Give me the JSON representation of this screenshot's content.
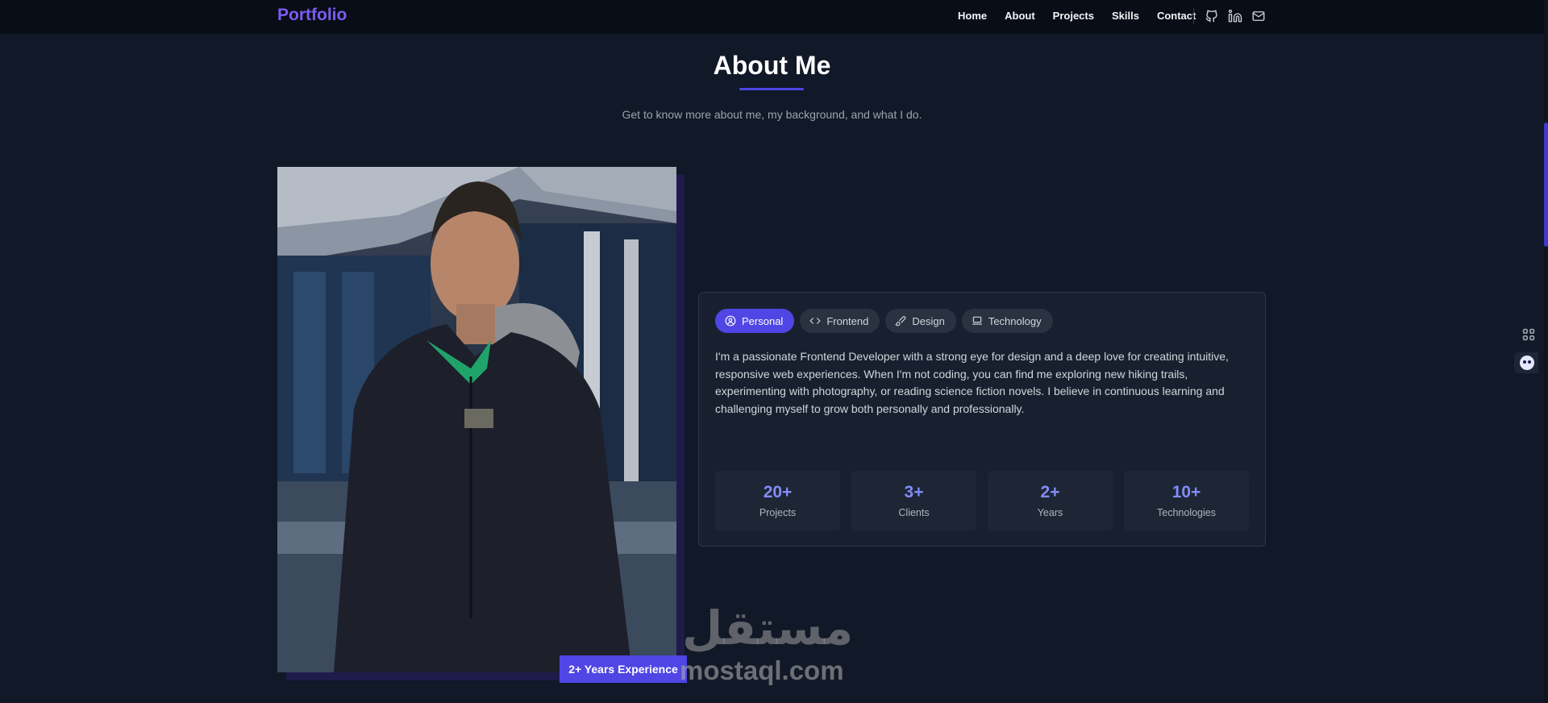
{
  "nav": {
    "brand": "Portfolio",
    "links": [
      "Home",
      "About",
      "Projects",
      "Skills",
      "Contact"
    ],
    "icons": [
      "github-icon",
      "linkedin-icon",
      "mail-icon"
    ]
  },
  "about": {
    "title": "About Me",
    "subtitle": "Get to know more about me, my background, and what I do.",
    "experience_badge": "2+ Years Experience",
    "tabs": [
      {
        "label": "Personal",
        "icon": "user-circle-icon",
        "active": true
      },
      {
        "label": "Frontend",
        "icon": "code-icon",
        "active": false
      },
      {
        "label": "Design",
        "icon": "brush-icon",
        "active": false
      },
      {
        "label": "Technology",
        "icon": "laptop-icon",
        "active": false
      }
    ],
    "description": "I'm a passionate Frontend Developer with a strong eye for design and a deep love for creating intuitive, responsive web experiences. When I'm not coding, you can find me exploring new hiking trails, experimenting with photography, or reading science fiction novels. I believe in continuous learning and challenging myself to grow both personally and professionally.",
    "stats": [
      {
        "value": "20+",
        "label": "Projects"
      },
      {
        "value": "3+",
        "label": "Clients"
      },
      {
        "value": "2+",
        "label": "Years"
      },
      {
        "value": "10+",
        "label": "Technologies"
      }
    ]
  },
  "watermark": {
    "arabic": "مستقل",
    "latin": "mostaql.com"
  },
  "colors": {
    "background": "#111827",
    "accent": "#4f46e5",
    "brand": "#7c5cf2",
    "stat_value": "#818cf8"
  }
}
